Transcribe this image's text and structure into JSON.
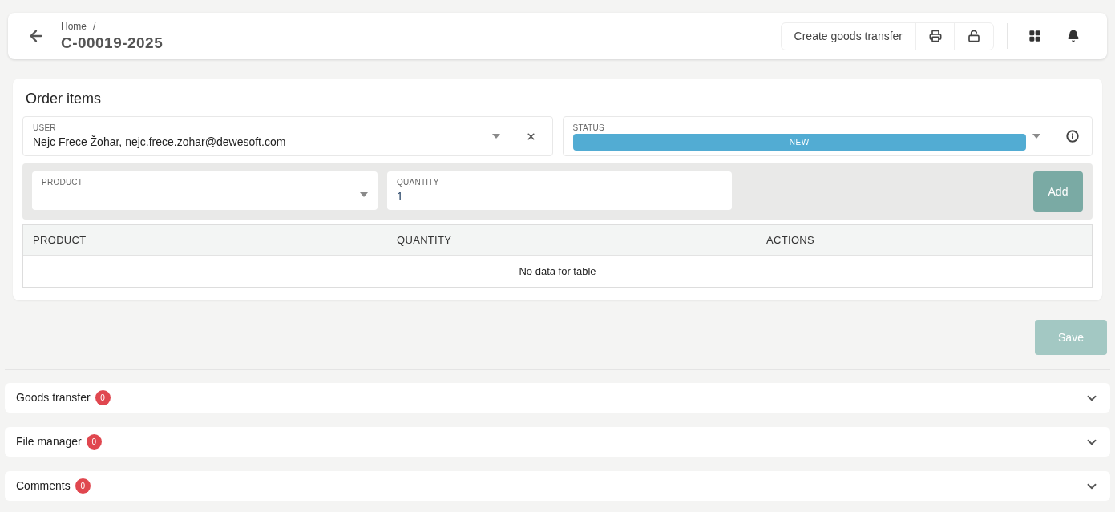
{
  "header": {
    "breadcrumb": "Home",
    "breadcrumb_separator": "/",
    "title": "C-00019-2025",
    "actions": [
      "Create goods transfer"
    ]
  },
  "order_items": {
    "title": "Order items",
    "user": {
      "label": "USER",
      "value": "Nejc Frece Žohar, nejc.frece.zohar@dewesoft.com"
    },
    "status": {
      "label": "STATUS",
      "value": "NEW",
      "color": "#52acd3"
    },
    "product": {
      "label": "PRODUCT"
    },
    "quantity": {
      "label": "QUANTITY",
      "value": "1"
    },
    "add_button": "Add",
    "table": {
      "columns": [
        "PRODUCT",
        "QUANTITY",
        "ACTIONS"
      ],
      "empty": "No data for table"
    }
  },
  "save_button": "Save",
  "sections": [
    {
      "title": "Goods transfer",
      "count": "0",
      "expanded": false
    },
    {
      "title": "File manager",
      "count": "0",
      "expanded": false
    },
    {
      "title": "Comments",
      "count": "0",
      "expanded": false
    }
  ]
}
